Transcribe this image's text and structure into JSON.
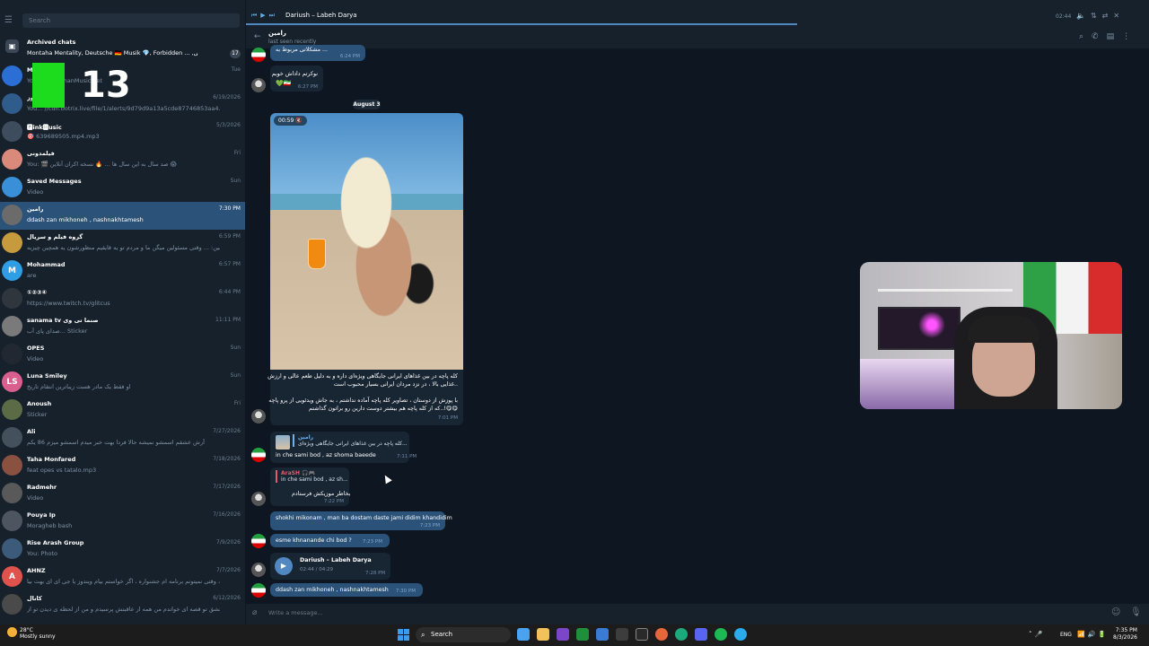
{
  "search": {
    "placeholder": "Search"
  },
  "archived": {
    "name": "Archived chats",
    "preview": "Montaha Mentality, Deutsche 🇩🇪 Musik 💎, Forbidden ... ,ترانه زنگی",
    "badge": "17"
  },
  "chats": [
    {
      "name": "Music",
      "preview": "Yo...  ...HamahanMusic.net",
      "time": "Tue",
      "avatar": "#2b6fd6",
      "initial": ""
    },
    {
      "name": "نیوز",
      "preview": "You... //cdn.botrix.live/file/1/alerts/9d79d9a13a5cde87746853aa4...",
      "time": "6/19/2026",
      "avatar": "#2f5c8a",
      "initial": ""
    },
    {
      "name": "🅿ink🅼usic",
      "preview": "🎯 639689505.mp4.mp3",
      "time": "5/3/2026",
      "avatar": "#3d4d5e",
      "initial": ""
    },
    {
      "name": "فیلمدونی",
      "preview": "You: 🎬 صد سال به این سال ها ... 🔥 نسخه اکران آنلاین 😱",
      "time": "Fri",
      "avatar": "#d98a7a",
      "initial": ""
    },
    {
      "name": "Saved Messages",
      "preview": "Video",
      "time": "Sun",
      "avatar": "#3a8fd9",
      "initial": ""
    },
    {
      "name": "رامین",
      "preview": "ddash zan mikhoneh , nashnakhtamesh",
      "time": "7:30 PM",
      "avatar": "#6b6b6b",
      "initial": ""
    },
    {
      "name": "گروه فیلم و سریال",
      "preview": "رامین: ... وقتی مسئولین میگن ما و مردم تو یه قایقیم منظورشون یه همچین چیزیه",
      "time": "6:59 PM",
      "avatar": "#c79b3d",
      "initial": ""
    },
    {
      "name": "Mohammad",
      "preview": "are",
      "time": "6:57 PM",
      "avatar": "#2f9ee4",
      "initial": "M"
    },
    {
      "name": "①②③④",
      "preview": "https://www.twitch.tv/glitcus",
      "time": "6:44 PM",
      "avatar": "#30363d",
      "initial": ""
    },
    {
      "name": "sanama tv صنما تی وی",
      "preview": "صدای پای آب... Sticker",
      "time": "11:11 PM",
      "avatar": "#7a7a7a",
      "initial": ""
    },
    {
      "name": "OPES",
      "preview": "Video",
      "time": "Sun",
      "avatar": "#222831",
      "initial": ""
    },
    {
      "name": "Luna Smiley",
      "preview": "او فقط یک مادر هست زیباترین انتقام تاریخ",
      "time": "Sun",
      "avatar": "#d95f8e",
      "initial": "LS"
    },
    {
      "name": "Anoush",
      "preview": "Sticker",
      "time": "Fri",
      "avatar": "#5a6b45",
      "initial": ""
    },
    {
      "name": "Ali",
      "preview": "آرش عشقم اسمشو نمیشه حالا فردا بهت خبر میدم اسمشو میزم 86 یکم",
      "time": "7/27/2026",
      "avatar": "#44505c",
      "initial": ""
    },
    {
      "name": "Taha Monfared",
      "preview": "feat opes vs tatalo.mp3",
      "time": "7/18/2026",
      "avatar": "#8a5040",
      "initial": ""
    },
    {
      "name": "Radmehr",
      "preview": "Video",
      "time": "7/17/2026",
      "avatar": "#595959",
      "initial": ""
    },
    {
      "name": "Pouya Ip",
      "preview": "Moragheb bash",
      "time": "7/16/2026",
      "avatar": "#4d5560",
      "initial": ""
    },
    {
      "name": "Rise Arash Group",
      "preview": "You: Photo",
      "time": "7/9/2026",
      "avatar": "#3c5a7a",
      "initial": ""
    },
    {
      "name": "AHNZ",
      "preview": "سلام آرش جون ، وقتی نمیتونم برنامه ام جشنواره ، اگر خواستم بیام ویندوز یا جی ای ای بهت بیا...",
      "time": "7/7/2026",
      "avatar": "#e0524c",
      "initial": "A"
    },
    {
      "name": "کانال",
      "preview": "هر جا که از عشق تو قصه ای خواندم من همه از عاقبتش پرسیدم و من از لحظه ی دیدن تو از ...",
      "time": "6/12/2026",
      "avatar": "#4a4a4a",
      "initial": ""
    }
  ],
  "player": {
    "title": "Dariush – Labeh Darya",
    "time": "02:44"
  },
  "peer": {
    "name": "رامین",
    "status": "last seen recently"
  },
  "date_sep": "August 3",
  "messages": {
    "m0_text": "مشکلاتی مربوط به ...",
    "m0_time": "6:24 PM",
    "m1_text": "نوکرتم داداش خوبم",
    "m1_time": "6:27 PM",
    "video_duration": "00:59",
    "cap1": "کله پاچه در بین غذاهای ایرانی جایگاهی ویژه‌ای داره و به دلیل طعم عالی و ارزش",
    "cap2": "غذایی بالا ، در نزد مردان ایرانی بسیار محبوب است..",
    "cap3": "با پوزش از دوستان ، تصاویر کله پاچه آماده نداشتم ، به جاش ویدئویی از پرو پاچه",
    "cap4": "که از کله پاچه هم بیشتر دوست دارین رو براتون گذاشتم..!😋😋",
    "cap_time": "7:01 PM",
    "r1_name": "رامین",
    "r1_quote": "کله پاچه در بین غذاهای ایرانی جایگاهی ویژه‌ای...",
    "r1_text": "in che sami bod , az shoma baeede",
    "r1_time": "7:11 PM",
    "r2_name": "AraSH 🎧🎮",
    "r2_quote": "in che sami bod , az sh...",
    "r2_text": "بخاطر موزیکش فرستادم",
    "r2_time": "7:22 PM",
    "m4_text": "shokhi mikonam , man ba dostam daste jami didim khandidim",
    "m4_time": "7:23 PM",
    "m5_text": "esme khnanande chi bod ?",
    "m5_time": "7:23 PM",
    "audio_title": "Dariush – Labeh Darya",
    "audio_time": "02:44 / 04:29",
    "audio_msg_time": "7:28 PM",
    "m6_text": "ddash zan mikhoneh , nashnakhtamesh",
    "m6_time": "7:30 PM"
  },
  "composer": {
    "placeholder": "Write a message..."
  },
  "overlay": {
    "number": "13"
  },
  "taskbar": {
    "temp": "28°C",
    "weather": "Mostly sunny",
    "search": "Search",
    "lang": "ENG",
    "time": "7:35 PM",
    "date": "8/3/2026"
  }
}
